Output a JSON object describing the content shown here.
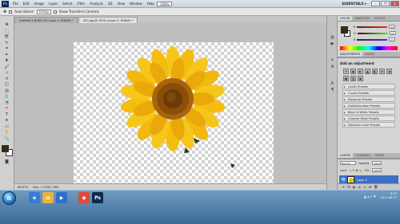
{
  "menubar": {
    "logo": "Ps",
    "items": [
      "File",
      "Edit",
      "Image",
      "Layer",
      "Select",
      "Filter",
      "Analysis",
      "3D",
      "View",
      "Window",
      "Help"
    ],
    "zoom": "100%",
    "workspace": "ESSENTIALS ▾",
    "window_buttons": [
      "–",
      "❐",
      "✕"
    ]
  },
  "options": {
    "auto_select_label": "Auto-Select:",
    "auto_select_value": "Group",
    "show_transform_label": "Show Transform Controls"
  },
  "tabs": [
    {
      "label": "Untitled-1 @ 66.7% (Layer 0, RGB/8) *"
    },
    {
      "label": "SF0.jpg @ 100% (Layer 0, RGB/8) *"
    }
  ],
  "status": {
    "zoom": "66.67%",
    "doc": "Doc: 1.37M/1.78M"
  },
  "color_panel": {
    "tabs": [
      "COLOR",
      "SWATCHES",
      "STYLES"
    ],
    "sliders": [
      {
        "label": "R",
        "value": "62",
        "color": "#e23b2c"
      },
      {
        "label": "G",
        "value": "40",
        "color": "#3caa3c"
      },
      {
        "label": "B",
        "value": "17",
        "color": "#3d5ee8"
      }
    ]
  },
  "adjustments": {
    "tabs": [
      "ADJUSTMENTS",
      "MASKS"
    ],
    "title": "Add an adjustment",
    "icons": [
      "☀",
      "▦",
      "◐",
      "▲",
      "◧",
      "⊞",
      "◑",
      "▣",
      "▥",
      "◉"
    ],
    "presets": [
      "Levels Presets",
      "Curves Presets",
      "Exposure Presets",
      "Hue/Saturation Presets",
      "Black & White Presets",
      "Channel Mixer Presets",
      "Selective Color Presets"
    ]
  },
  "layers_panel": {
    "tabs": [
      "LAYERS",
      "CHANNELS",
      "PATHS"
    ],
    "blend_mode": "Normal",
    "opacity_label": "Opacity:",
    "opacity_value": "100%",
    "lock_label": "Lock:",
    "fill_label": "Fill:",
    "fill_value": "100%",
    "layer_name": "Layer 0",
    "footer_icons": [
      "⚭",
      "fx",
      "◐",
      "◎",
      "▭",
      "⊞",
      "🗑"
    ]
  },
  "taskbar": {
    "start_glyph": "⊞",
    "apps": [
      {
        "glyph": "e",
        "color": "#3a7bd5"
      },
      {
        "glyph": "▤",
        "color": "#e9b23c"
      },
      {
        "glyph": "▶",
        "color": "#2f6ecb"
      },
      {
        "glyph": "◉",
        "color": "#dd4b39"
      },
      {
        "glyph": "Ps",
        "color": "#0d2a4a"
      }
    ],
    "tray_icons": "▲ ◂ ♪ ⚑",
    "time": "8:37",
    "date": "2011-06-27"
  }
}
